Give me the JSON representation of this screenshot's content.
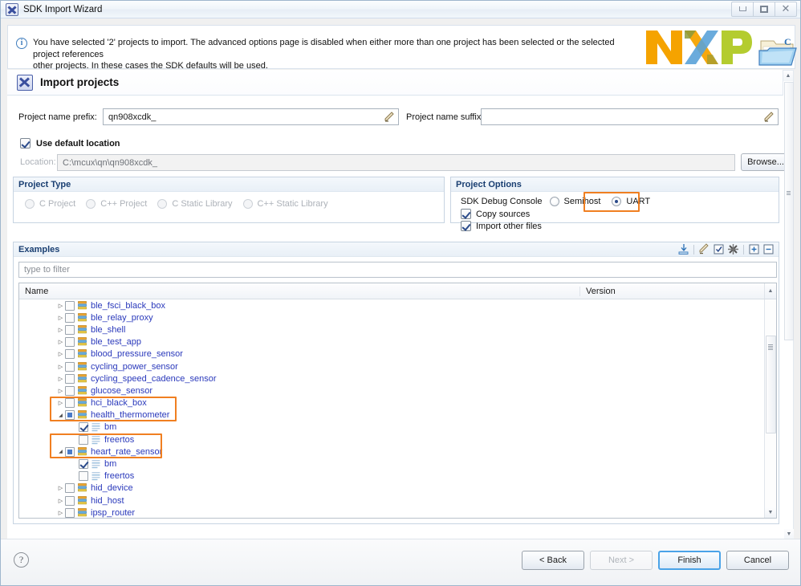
{
  "window": {
    "title": "SDK Import Wizard",
    "icon": "x-badge-icon",
    "controls": {
      "minimize": "minimize-icon",
      "restore": "restore-icon",
      "close": "close-icon"
    }
  },
  "banner": {
    "info_icon": "info-icon",
    "message_line1": "You have selected '2' projects to import. The advanced options page is disabled when either more than one project has been selected or the selected project references",
    "message_line2": "other projects. In these cases the SDK defaults will be used.",
    "logo": {
      "alt": "nxp-logo",
      "colors": {
        "n": "#f5a300",
        "x_left": "#8a9a3c",
        "x_right": "#5aa2d8",
        "p": "#b4cc2f"
      }
    }
  },
  "page": {
    "title": "Import projects",
    "icon": "x-badge-icon"
  },
  "form": {
    "prefix_label": "Project name prefix:",
    "prefix_value": "qn908xcdk_",
    "suffix_label": "Project name suffix:",
    "suffix_value": "",
    "use_default_location_label": "Use default location",
    "use_default_location_checked": true,
    "location_label": "Location:",
    "location_value": "C:\\mcux\\qn\\qn908xcdk_",
    "browse_label": "Browse...",
    "edit_icon": "pencil-edit-icon"
  },
  "project_type": {
    "title": "Project Type",
    "options": [
      {
        "label": "C Project",
        "selected": false,
        "disabled": true
      },
      {
        "label": "C++ Project",
        "selected": false,
        "disabled": true
      },
      {
        "label": "C Static Library",
        "selected": false,
        "disabled": true
      },
      {
        "label": "C++ Static Library",
        "selected": false,
        "disabled": true
      }
    ]
  },
  "project_options": {
    "title": "Project Options",
    "debug_console_label": "SDK Debug Console",
    "debug_console_options": [
      {
        "label": "Semihost",
        "selected": false
      },
      {
        "label": "UART",
        "selected": true,
        "highlighted": true
      }
    ],
    "checkboxes": [
      {
        "label": "Copy sources",
        "checked": true
      },
      {
        "label": "Import other files",
        "checked": true
      }
    ]
  },
  "examples": {
    "title": "Examples",
    "filter_placeholder": "type to filter",
    "toolbar_icons": [
      "import-icon",
      "eraser-icon",
      "select-all-icon",
      "clear-selection-icon",
      "expand-all-icon",
      "collapse-all-icon"
    ],
    "columns": {
      "name": "Name",
      "version": "Version"
    },
    "tree": [
      {
        "label": "ble_fsci_black_box",
        "depth": 1,
        "twisty": "collapsed",
        "check": "unchecked",
        "icon": "stack-icon",
        "highlight": false
      },
      {
        "label": "ble_relay_proxy",
        "depth": 1,
        "twisty": "collapsed",
        "check": "unchecked",
        "icon": "stack-icon",
        "highlight": false
      },
      {
        "label": "ble_shell",
        "depth": 1,
        "twisty": "collapsed",
        "check": "unchecked",
        "icon": "stack-icon",
        "highlight": false
      },
      {
        "label": "ble_test_app",
        "depth": 1,
        "twisty": "collapsed",
        "check": "unchecked",
        "icon": "stack-icon",
        "highlight": false
      },
      {
        "label": "blood_pressure_sensor",
        "depth": 1,
        "twisty": "collapsed",
        "check": "unchecked",
        "icon": "stack-icon",
        "highlight": false
      },
      {
        "label": "cycling_power_sensor",
        "depth": 1,
        "twisty": "collapsed",
        "check": "unchecked",
        "icon": "stack-icon",
        "highlight": false
      },
      {
        "label": "cycling_speed_cadence_sensor",
        "depth": 1,
        "twisty": "collapsed",
        "check": "unchecked",
        "icon": "stack-icon",
        "highlight": false
      },
      {
        "label": "glucose_sensor",
        "depth": 1,
        "twisty": "collapsed",
        "check": "unchecked",
        "icon": "stack-icon",
        "highlight": false
      },
      {
        "label": "hci_black_box",
        "depth": 1,
        "twisty": "collapsed",
        "check": "unchecked",
        "icon": "stack-icon",
        "highlight": false
      },
      {
        "label": "health_thermometer",
        "depth": 1,
        "twisty": "expanded",
        "check": "partial",
        "icon": "stack-icon",
        "highlight": true
      },
      {
        "label": "bm",
        "depth": 2,
        "twisty": "none",
        "check": "checked",
        "icon": "lines-icon",
        "highlight": true
      },
      {
        "label": "freertos",
        "depth": 2,
        "twisty": "none",
        "check": "unchecked",
        "icon": "lines-icon",
        "highlight": false
      },
      {
        "label": "heart_rate_sensor",
        "depth": 1,
        "twisty": "expanded",
        "check": "partial",
        "icon": "stack-icon",
        "highlight": true
      },
      {
        "label": "bm",
        "depth": 2,
        "twisty": "none",
        "check": "checked",
        "icon": "lines-icon",
        "highlight": true
      },
      {
        "label": "freertos",
        "depth": 2,
        "twisty": "none",
        "check": "unchecked",
        "icon": "lines-icon",
        "highlight": false
      },
      {
        "label": "hid_device",
        "depth": 1,
        "twisty": "collapsed",
        "check": "unchecked",
        "icon": "stack-icon",
        "highlight": false
      },
      {
        "label": "hid_host",
        "depth": 1,
        "twisty": "collapsed",
        "check": "unchecked",
        "icon": "stack-icon",
        "highlight": false
      },
      {
        "label": "ipsp_router",
        "depth": 1,
        "twisty": "collapsed",
        "check": "unchecked",
        "icon": "stack-icon",
        "highlight": false
      }
    ]
  },
  "footer": {
    "help_icon": "help-icon",
    "buttons": [
      {
        "label": "< Back",
        "state": "enabled"
      },
      {
        "label": "Next >",
        "state": "disabled"
      },
      {
        "label": "Finish",
        "state": "default"
      },
      {
        "label": "Cancel",
        "state": "enabled"
      }
    ]
  },
  "colors": {
    "highlight_orange": "#f07f21",
    "link_blue": "#2a39bb",
    "group_title_blue": "#1a3f72"
  }
}
